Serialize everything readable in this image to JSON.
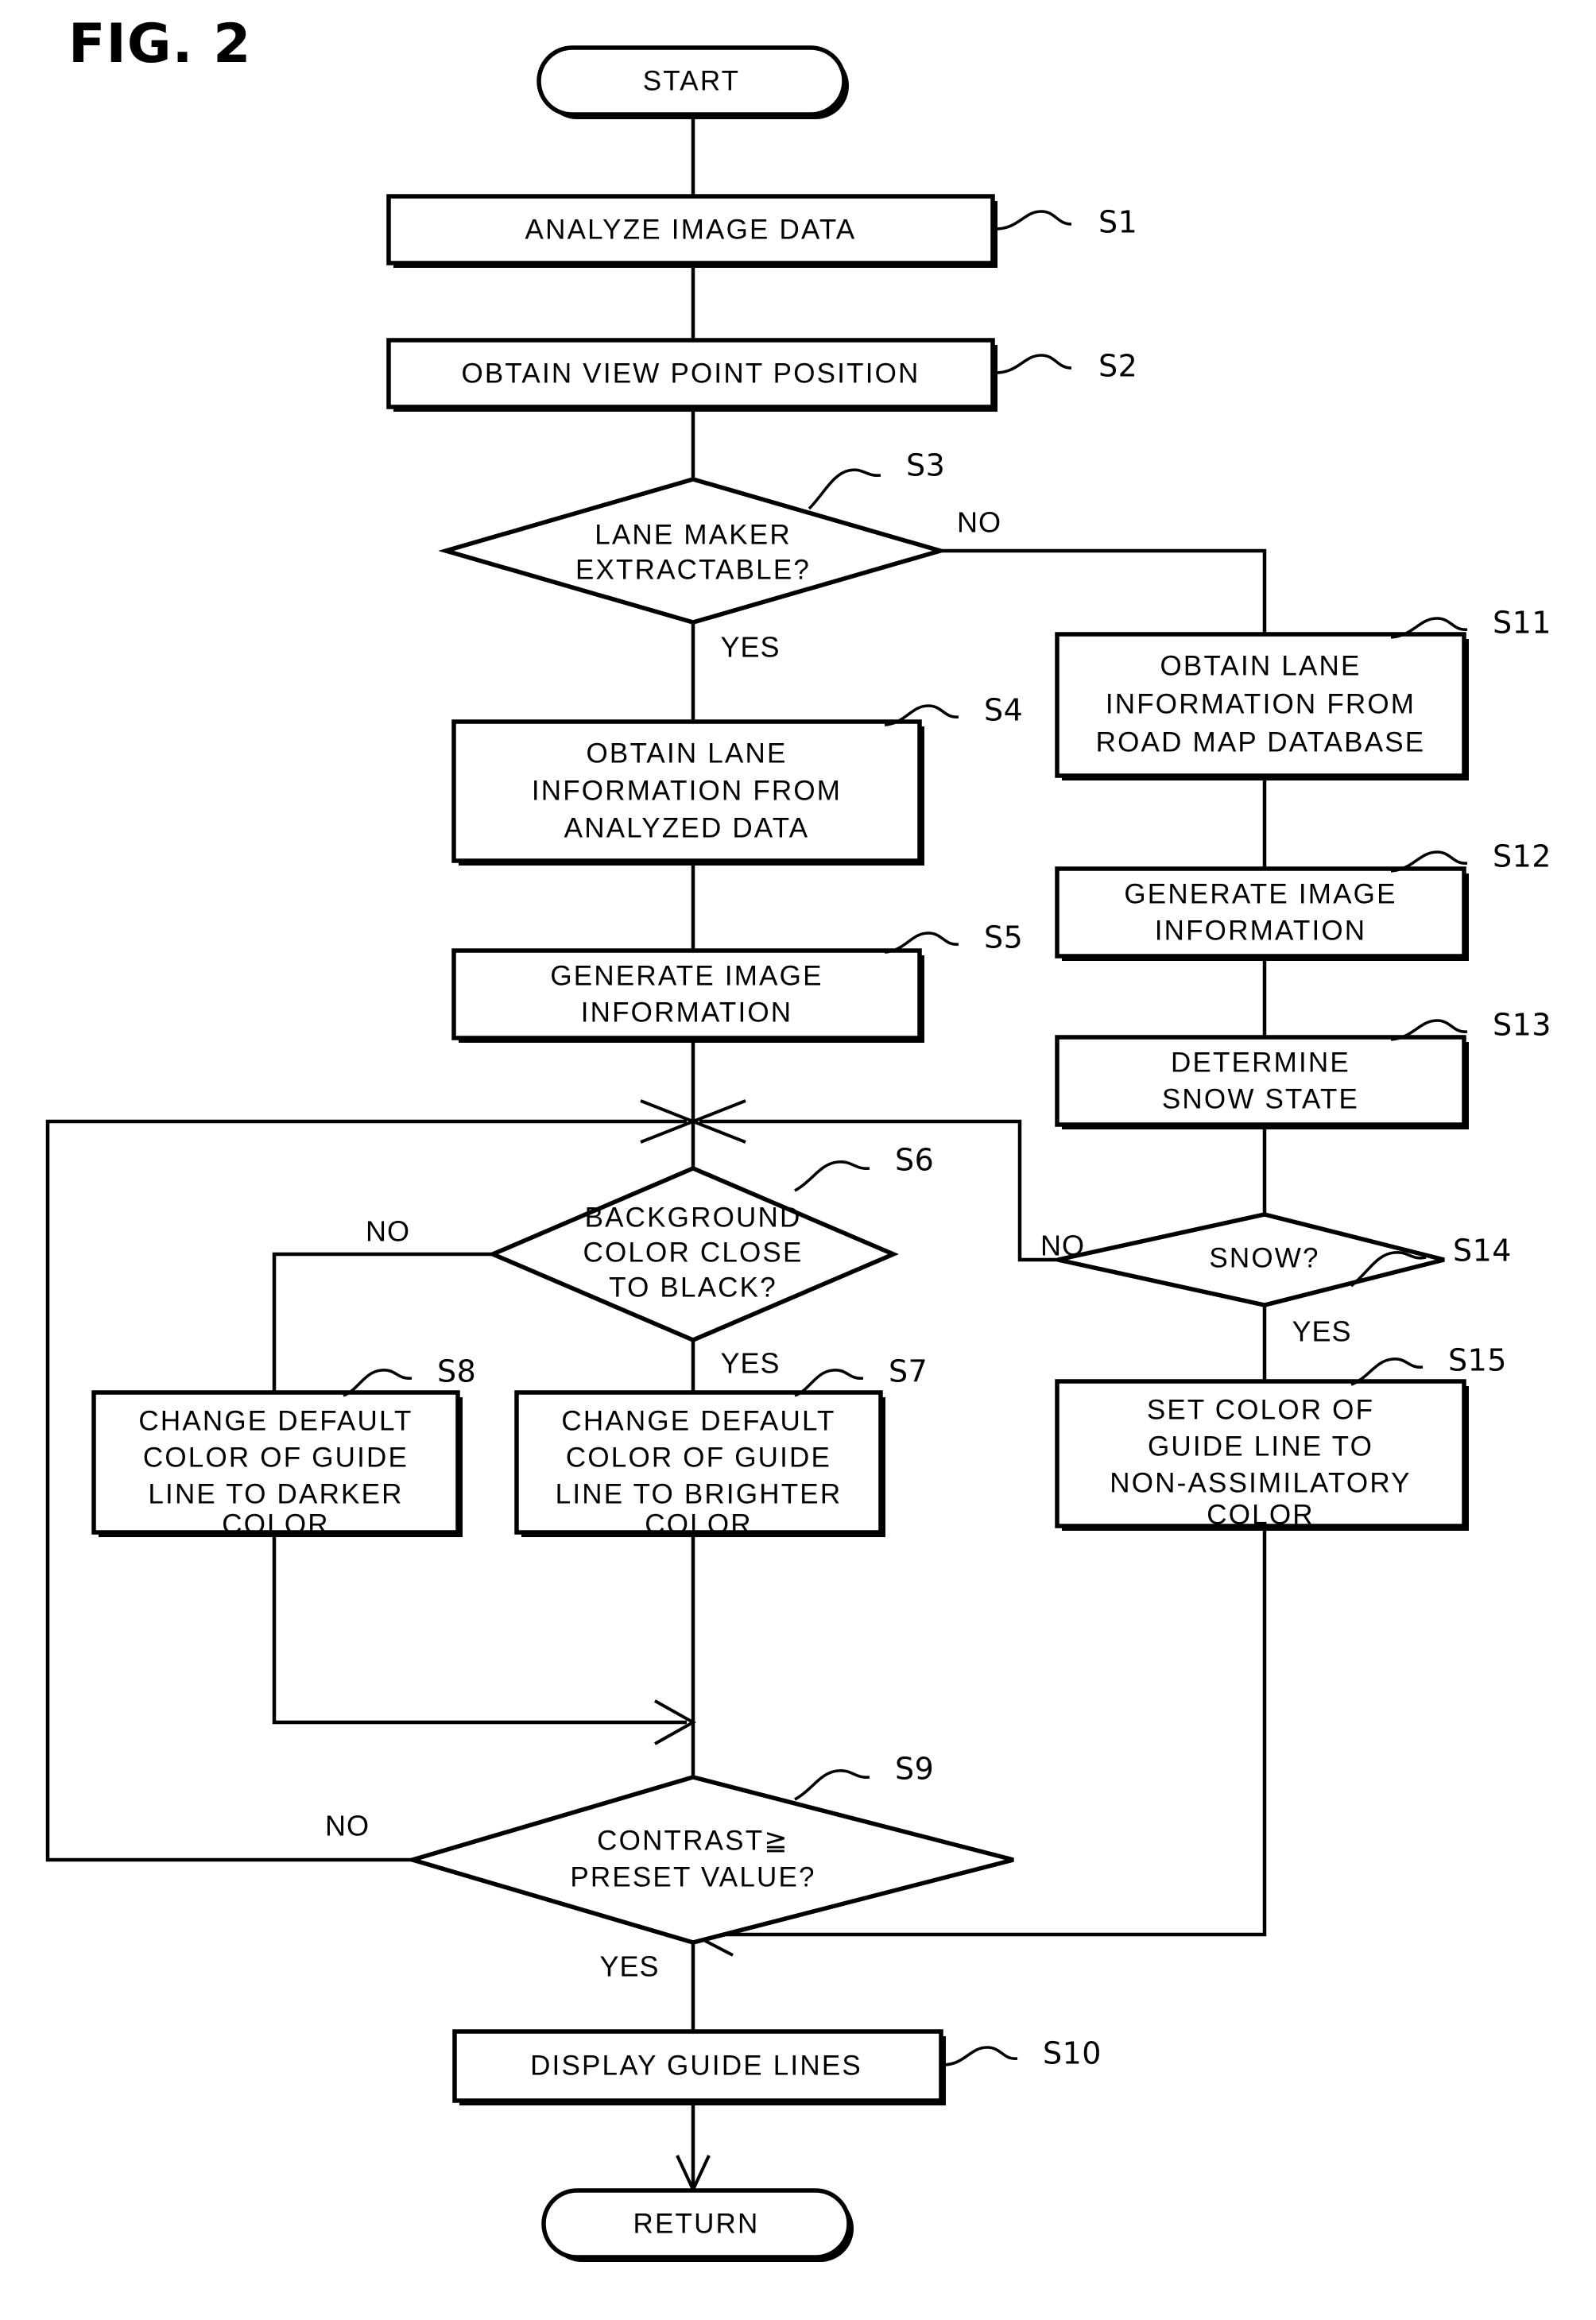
{
  "figure": {
    "title": "FIG. 2",
    "type": "flowchart"
  },
  "nodes": {
    "start": {
      "id": "start",
      "shape": "terminator",
      "label": "START"
    },
    "s1": {
      "id": "S1",
      "shape": "process",
      "label": "ANALYZE IMAGE DATA",
      "step": "S1"
    },
    "s2": {
      "id": "S2",
      "shape": "process",
      "label": "OBTAIN VIEW POINT POSITION",
      "step": "S2"
    },
    "s3": {
      "id": "S3",
      "shape": "decision",
      "line1": "LANE MAKER",
      "line2": "EXTRACTABLE?",
      "step": "S3"
    },
    "s4": {
      "id": "S4",
      "shape": "process",
      "line1": "OBTAIN LANE",
      "line2": "INFORMATION FROM",
      "line3": "ANALYZED DATA",
      "step": "S4"
    },
    "s5": {
      "id": "S5",
      "shape": "process",
      "line1": "GENERATE IMAGE",
      "line2": "INFORMATION",
      "step": "S5"
    },
    "s6": {
      "id": "S6",
      "shape": "decision",
      "line1": "BACKGROUND",
      "line2": "COLOR CLOSE",
      "line3": "TO BLACK?",
      "step": "S6"
    },
    "s7": {
      "id": "S7",
      "shape": "process",
      "line1": "CHANGE DEFAULT",
      "line2": "COLOR OF GUIDE",
      "line3": "LINE TO BRIGHTER",
      "line4": "COLOR",
      "step": "S7"
    },
    "s8": {
      "id": "S8",
      "shape": "process",
      "line1": "CHANGE DEFAULT",
      "line2": "COLOR OF GUIDE",
      "line3": "LINE TO DARKER",
      "line4": "COLOR",
      "step": "S8"
    },
    "s9": {
      "id": "S9",
      "shape": "decision",
      "line1": "CONTRAST≧",
      "line2": "PRESET VALUE?",
      "step": "S9"
    },
    "s10": {
      "id": "S10",
      "shape": "process",
      "label": "DISPLAY GUIDE LINES",
      "step": "S10"
    },
    "s11": {
      "id": "S11",
      "shape": "process",
      "line1": "OBTAIN LANE",
      "line2": "INFORMATION FROM",
      "line3": "ROAD MAP DATABASE",
      "step": "S11"
    },
    "s12": {
      "id": "S12",
      "shape": "process",
      "line1": "GENERATE IMAGE",
      "line2": "INFORMATION",
      "step": "S12"
    },
    "s13": {
      "id": "S13",
      "shape": "process",
      "line1": "DETERMINE",
      "line2": "SNOW STATE",
      "step": "S13"
    },
    "s14": {
      "id": "S14",
      "shape": "decision",
      "line1": "SNOW?",
      "step": "S14"
    },
    "s15": {
      "id": "S15",
      "shape": "process",
      "line1": "SET COLOR OF",
      "line2": "GUIDE LINE TO",
      "line3": "NON-ASSIMILATORY",
      "line4": "COLOR",
      "step": "S15"
    },
    "return": {
      "id": "return",
      "shape": "terminator",
      "label": "RETURN"
    }
  },
  "branch_labels": {
    "s3_no": "NO",
    "s3_yes": "YES",
    "s6_no": "NO",
    "s6_yes": "YES",
    "s9_no": "NO",
    "s9_yes": "YES",
    "s14_no": "NO",
    "s14_yes": "YES"
  },
  "colors": {
    "ink": "#000000",
    "paper": "#ffffff"
  }
}
